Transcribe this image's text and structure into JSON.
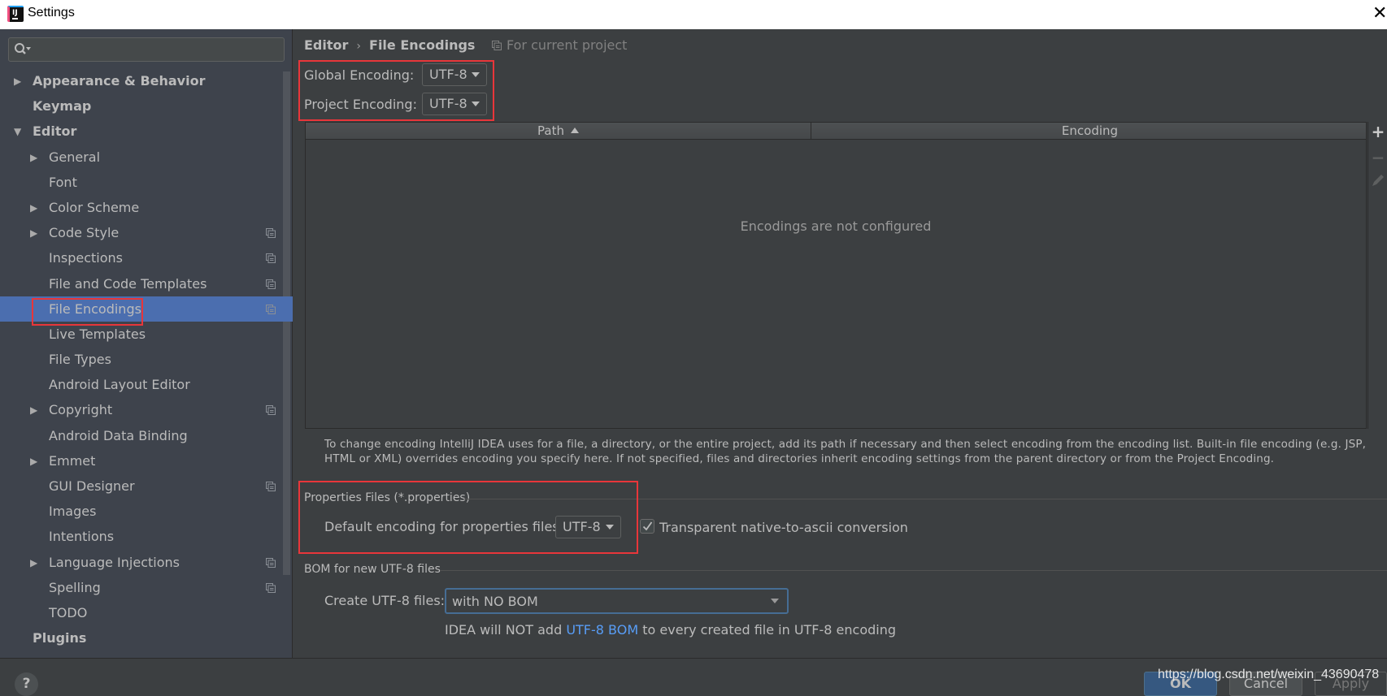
{
  "window": {
    "title": "Settings",
    "app_icon": "intellij-idea-icon",
    "close_icon": "close-icon"
  },
  "sidebar": {
    "search": {
      "value": "",
      "placeholder": "",
      "icon": "search-icon"
    },
    "items": [
      {
        "label": "Appearance & Behavior",
        "level": 0,
        "bold": true,
        "arrow": "collapsed",
        "project_icon": false,
        "selected": false
      },
      {
        "label": "Keymap",
        "level": 0,
        "bold": true,
        "arrow": "none",
        "project_icon": false,
        "selected": false
      },
      {
        "label": "Editor",
        "level": 0,
        "bold": true,
        "arrow": "expanded",
        "project_icon": false,
        "selected": false
      },
      {
        "label": "General",
        "level": 1,
        "bold": false,
        "arrow": "collapsed",
        "project_icon": false,
        "selected": false
      },
      {
        "label": "Font",
        "level": 1,
        "bold": false,
        "arrow": "none",
        "project_icon": false,
        "selected": false
      },
      {
        "label": "Color Scheme",
        "level": 1,
        "bold": false,
        "arrow": "collapsed",
        "project_icon": false,
        "selected": false
      },
      {
        "label": "Code Style",
        "level": 1,
        "bold": false,
        "arrow": "collapsed",
        "project_icon": true,
        "selected": false
      },
      {
        "label": "Inspections",
        "level": 1,
        "bold": false,
        "arrow": "none",
        "project_icon": true,
        "selected": false
      },
      {
        "label": "File and Code Templates",
        "level": 1,
        "bold": false,
        "arrow": "none",
        "project_icon": true,
        "selected": false
      },
      {
        "label": "File Encodings",
        "level": 1,
        "bold": false,
        "arrow": "none",
        "project_icon": true,
        "selected": true
      },
      {
        "label": "Live Templates",
        "level": 1,
        "bold": false,
        "arrow": "none",
        "project_icon": false,
        "selected": false
      },
      {
        "label": "File Types",
        "level": 1,
        "bold": false,
        "arrow": "none",
        "project_icon": false,
        "selected": false
      },
      {
        "label": "Android Layout Editor",
        "level": 1,
        "bold": false,
        "arrow": "none",
        "project_icon": false,
        "selected": false
      },
      {
        "label": "Copyright",
        "level": 1,
        "bold": false,
        "arrow": "collapsed",
        "project_icon": true,
        "selected": false
      },
      {
        "label": "Android Data Binding",
        "level": 1,
        "bold": false,
        "arrow": "none",
        "project_icon": false,
        "selected": false
      },
      {
        "label": "Emmet",
        "level": 1,
        "bold": false,
        "arrow": "collapsed",
        "project_icon": false,
        "selected": false
      },
      {
        "label": "GUI Designer",
        "level": 1,
        "bold": false,
        "arrow": "none",
        "project_icon": true,
        "selected": false
      },
      {
        "label": "Images",
        "level": 1,
        "bold": false,
        "arrow": "none",
        "project_icon": false,
        "selected": false
      },
      {
        "label": "Intentions",
        "level": 1,
        "bold": false,
        "arrow": "none",
        "project_icon": false,
        "selected": false
      },
      {
        "label": "Language Injections",
        "level": 1,
        "bold": false,
        "arrow": "collapsed",
        "project_icon": true,
        "selected": false
      },
      {
        "label": "Spelling",
        "level": 1,
        "bold": false,
        "arrow": "none",
        "project_icon": true,
        "selected": false
      },
      {
        "label": "TODO",
        "level": 1,
        "bold": false,
        "arrow": "none",
        "project_icon": false,
        "selected": false
      },
      {
        "label": "Plugins",
        "level": 0,
        "bold": true,
        "arrow": "none",
        "project_icon": false,
        "selected": false
      }
    ]
  },
  "main": {
    "breadcrumb": {
      "parent": "Editor",
      "separator": "›",
      "current": "File Encodings"
    },
    "for_current_project": "For current project",
    "global_encoding": {
      "label": "Global Encoding:",
      "value": "UTF-8"
    },
    "project_encoding": {
      "label": "Project Encoding:",
      "value": "UTF-8"
    },
    "table": {
      "columns": [
        {
          "label": "Path",
          "sort": "ascending"
        },
        {
          "label": "Encoding"
        }
      ],
      "rows": [],
      "empty_text": "Encodings are not configured",
      "tools": {
        "add": "+",
        "remove": "−",
        "edit": "edit-icon"
      }
    },
    "help_text": "To change encoding IntelliJ IDEA uses for a file, a directory, or the entire project, add its path if necessary and then select encoding from the encoding list. Built-in file encoding (e.g. JSP, HTML or XML) overrides encoding you specify here. If not specified, files and directories inherit encoding settings from the parent directory or from the Project Encoding.",
    "properties_group": {
      "title": "Properties Files (*.properties)",
      "default_label": "Default encoding for properties files:",
      "default_value": "UTF-8",
      "transparent_label": "Transparent native-to-ascii conversion",
      "transparent_checked": true
    },
    "bom_group": {
      "title": "BOM for new UTF-8 files",
      "create_label": "Create UTF-8 files:",
      "create_value": "with NO BOM",
      "note_prefix": "IDEA will NOT add ",
      "note_link": "UTF-8 BOM",
      "note_suffix": " to every created file in UTF-8 encoding"
    }
  },
  "footer": {
    "help": "?",
    "ok": "OK",
    "cancel": "Cancel",
    "apply": "Apply",
    "watermark": "https://blog.csdn.net/weixin_43690478"
  },
  "colors": {
    "selection": "#4b6eaf",
    "highlight_box": "#e8363a",
    "link": "#589df6",
    "ok_button": "#365880"
  }
}
